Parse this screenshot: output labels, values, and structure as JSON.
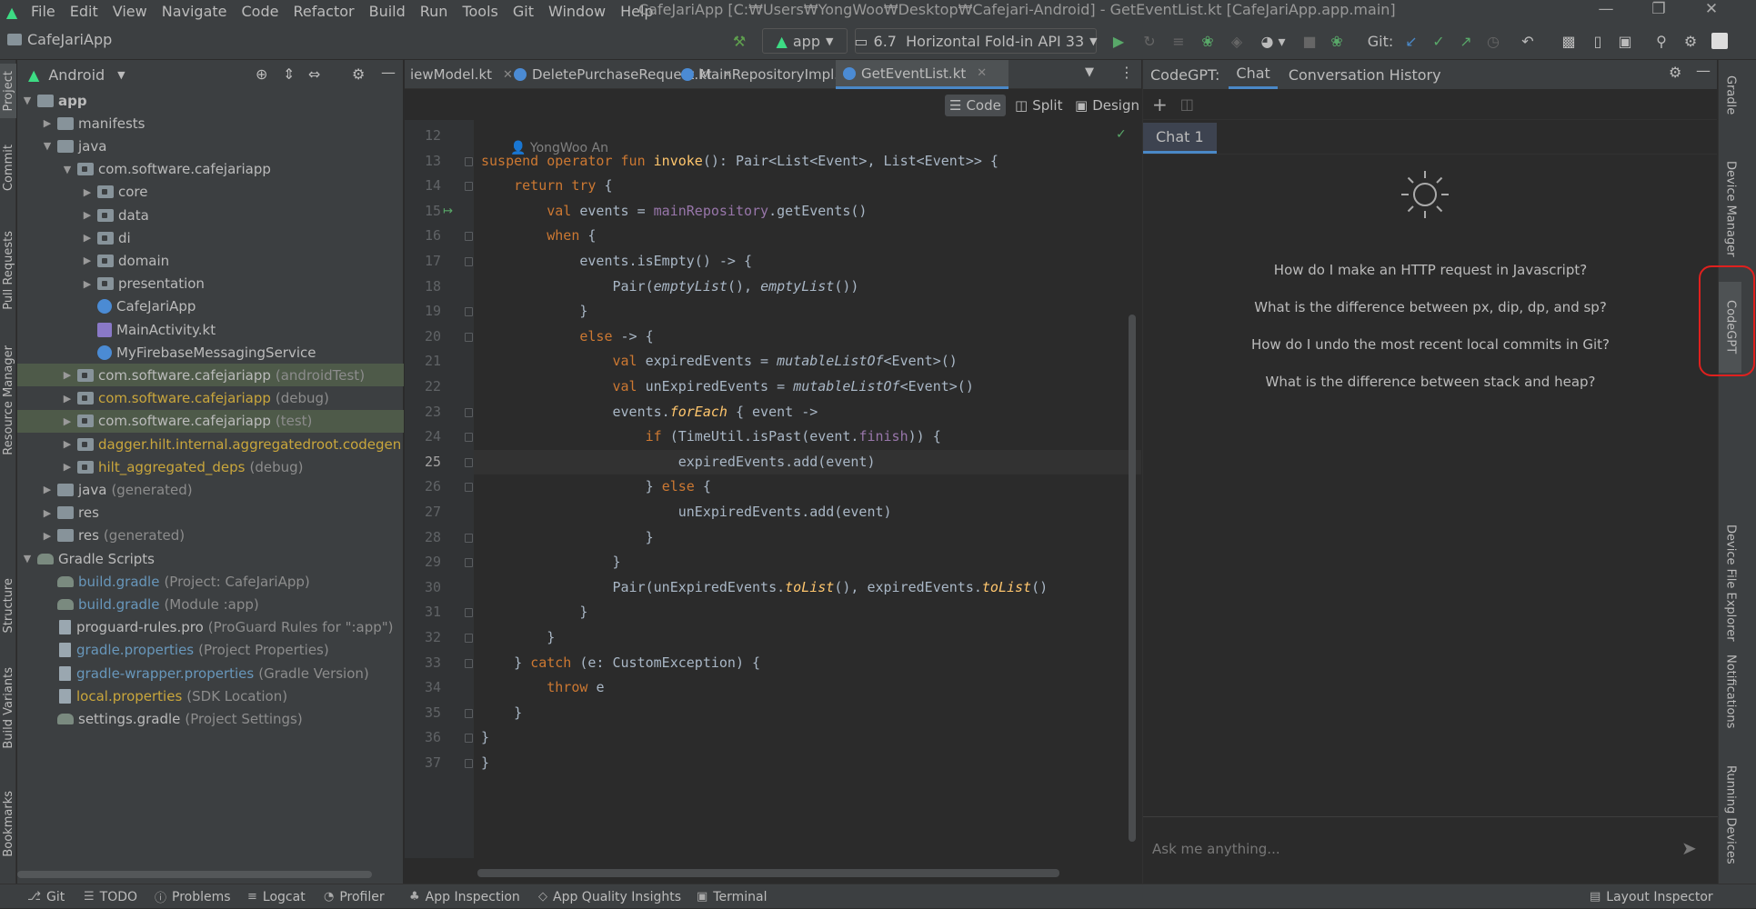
{
  "window": {
    "title": "CafeJariApp [C:₩Users₩YongWoo₩Desktop₩Cafejari-Android] - GetEventList.kt [CafeJariApp.app.main]",
    "menu": [
      "File",
      "Edit",
      "View",
      "Navigate",
      "Code",
      "Refactor",
      "Build",
      "Run",
      "Tools",
      "Git",
      "Window",
      "Help"
    ]
  },
  "toolbar": {
    "project_name": "CafeJariApp",
    "run_config": "app",
    "device": "6.7  Horizontal Fold-in API 33",
    "git_label": "Git:"
  },
  "left_strip": [
    "Project",
    "Commit",
    "Pull Requests",
    "Resource Manager",
    "Structure",
    "Build Variants",
    "Bookmarks"
  ],
  "right_strip": [
    "Gradle",
    "Device Manager",
    "CodeGPT",
    "Device File Explorer",
    "Notifications",
    "Running Devices"
  ],
  "project": {
    "view_mode": "Android",
    "tree": [
      {
        "label": "app",
        "hint": "",
        "depth": 0,
        "icon": "folder",
        "color": "normal",
        "arrow": "down",
        "bold": true
      },
      {
        "label": "manifests",
        "hint": "",
        "depth": 1,
        "icon": "folder",
        "color": "normal",
        "arrow": "right"
      },
      {
        "label": "java",
        "hint": "",
        "depth": 1,
        "icon": "folder",
        "color": "normal",
        "arrow": "down"
      },
      {
        "label": "com.software.cafejariapp",
        "hint": "",
        "depth": 2,
        "icon": "pkg",
        "color": "normal",
        "arrow": "down"
      },
      {
        "label": "core",
        "hint": "",
        "depth": 3,
        "icon": "pkg",
        "color": "normal",
        "arrow": "right"
      },
      {
        "label": "data",
        "hint": "",
        "depth": 3,
        "icon": "pkg",
        "color": "normal",
        "arrow": "right"
      },
      {
        "label": "di",
        "hint": "",
        "depth": 3,
        "icon": "pkg",
        "color": "normal",
        "arrow": "right"
      },
      {
        "label": "domain",
        "hint": "",
        "depth": 3,
        "icon": "pkg",
        "color": "normal",
        "arrow": "right"
      },
      {
        "label": "presentation",
        "hint": "",
        "depth": 3,
        "icon": "pkg",
        "color": "normal",
        "arrow": "right"
      },
      {
        "label": "CafeJariApp",
        "hint": "",
        "depth": 3,
        "icon": "kotlin-class",
        "color": "normal",
        "arrow": "none"
      },
      {
        "label": "MainActivity.kt",
        "hint": "",
        "depth": 3,
        "icon": "kotlin-file",
        "color": "normal",
        "arrow": "none"
      },
      {
        "label": "MyFirebaseMessagingService",
        "hint": "",
        "depth": 3,
        "icon": "kotlin-class",
        "color": "normal",
        "arrow": "none"
      },
      {
        "label": "com.software.cafejariapp",
        "hint": "(androidTest)",
        "depth": 2,
        "icon": "pkg",
        "color": "normal",
        "arrow": "right",
        "selected": true
      },
      {
        "label": "com.software.cafejariapp",
        "hint": "(debug)",
        "depth": 2,
        "icon": "pkg",
        "color": "yellow",
        "arrow": "right"
      },
      {
        "label": "com.software.cafejariapp",
        "hint": "(test)",
        "depth": 2,
        "icon": "pkg",
        "color": "normal",
        "arrow": "right",
        "selected": true
      },
      {
        "label": "dagger.hilt.internal.aggregatedroot.codegen",
        "hint": "(de",
        "depth": 2,
        "icon": "pkg",
        "color": "yellow",
        "arrow": "right"
      },
      {
        "label": "hilt_aggregated_deps",
        "hint": "(debug)",
        "depth": 2,
        "icon": "pkg",
        "color": "yellow",
        "arrow": "right"
      },
      {
        "label": "java",
        "hint": "(generated)",
        "depth": 1,
        "icon": "folder",
        "color": "normal",
        "arrow": "right"
      },
      {
        "label": "res",
        "hint": "",
        "depth": 1,
        "icon": "folder",
        "color": "normal",
        "arrow": "right"
      },
      {
        "label": "res",
        "hint": "(generated)",
        "depth": 1,
        "icon": "folder",
        "color": "normal",
        "arrow": "right"
      },
      {
        "label": "Gradle Scripts",
        "hint": "",
        "depth": 0,
        "icon": "gradle",
        "color": "normal",
        "arrow": "down"
      },
      {
        "label": "build.gradle",
        "hint": "(Project: CafeJariApp)",
        "depth": 1,
        "icon": "gradle",
        "color": "blue",
        "arrow": "none"
      },
      {
        "label": "build.gradle",
        "hint": "(Module :app)",
        "depth": 1,
        "icon": "gradle",
        "color": "blue",
        "arrow": "none"
      },
      {
        "label": "proguard-rules.pro",
        "hint": "(ProGuard Rules for \":app\")",
        "depth": 1,
        "icon": "file",
        "color": "normal",
        "arrow": "none"
      },
      {
        "label": "gradle.properties",
        "hint": "(Project Properties)",
        "depth": 1,
        "icon": "file",
        "color": "blue",
        "arrow": "none"
      },
      {
        "label": "gradle-wrapper.properties",
        "hint": "(Gradle Version)",
        "depth": 1,
        "icon": "file",
        "color": "blue",
        "arrow": "none"
      },
      {
        "label": "local.properties",
        "hint": "(SDK Location)",
        "depth": 1,
        "icon": "file",
        "color": "yellow",
        "arrow": "none"
      },
      {
        "label": "settings.gradle",
        "hint": "(Project Settings)",
        "depth": 1,
        "icon": "gradle",
        "color": "normal",
        "arrow": "none"
      }
    ]
  },
  "editor": {
    "tabs": [
      {
        "label": "iewModel.kt",
        "active": false
      },
      {
        "label": "DeletePurchaseRequest.kt",
        "active": false
      },
      {
        "label": "MainRepositoryImpl.kt",
        "active": false
      },
      {
        "label": "GetEventList.kt",
        "active": true
      }
    ],
    "modes": [
      "Code",
      "Split",
      "Design"
    ],
    "author": "YongWoo An",
    "first_line": 12,
    "current_line": 25,
    "lines": [
      [],
      [
        [
          "kw",
          "suspend operator fun "
        ],
        [
          "fn",
          "invoke"
        ],
        [
          "",
          "(): Pair<List<Event>, List<Event>> {"
        ]
      ],
      [
        [
          "",
          "    "
        ],
        [
          "kw",
          "return try "
        ],
        [
          "",
          "{"
        ]
      ],
      [
        [
          "",
          "        "
        ],
        [
          "kw",
          "val "
        ],
        [
          "",
          "events = "
        ],
        [
          "pp",
          "mainRepository"
        ],
        [
          "",
          ".getEvents()"
        ]
      ],
      [
        [
          "",
          "        "
        ],
        [
          "kw",
          "when "
        ],
        [
          "",
          "{"
        ]
      ],
      [
        [
          "",
          "            events.isEmpty() -> {"
        ]
      ],
      [
        [
          "",
          "                Pair("
        ],
        [
          "it",
          "emptyList"
        ],
        [
          "",
          "(), "
        ],
        [
          "it",
          "emptyList"
        ],
        [
          "",
          "())"
        ]
      ],
      [
        [
          "",
          "            }"
        ]
      ],
      [
        [
          "",
          "            "
        ],
        [
          "kw",
          "else "
        ],
        [
          "",
          "-> {"
        ]
      ],
      [
        [
          "",
          "                "
        ],
        [
          "kw",
          "val "
        ],
        [
          "",
          "expiredEvents = "
        ],
        [
          "it",
          "mutableListOf"
        ],
        [
          "",
          "<Event>()"
        ]
      ],
      [
        [
          "",
          "                "
        ],
        [
          "kw",
          "val "
        ],
        [
          "",
          "unExpiredEvents = "
        ],
        [
          "it",
          "mutableListOf"
        ],
        [
          "",
          "<Event>()"
        ]
      ],
      [
        [
          "",
          "                events."
        ],
        [
          "itf",
          "forEach"
        ],
        [
          "",
          " { event ->"
        ]
      ],
      [
        [
          "",
          "                    "
        ],
        [
          "kw",
          "if "
        ],
        [
          "",
          "(TimeUtil.isPast(event."
        ],
        [
          "pp",
          "finish"
        ],
        [
          "",
          ")) {"
        ]
      ],
      [
        [
          "",
          "                        expiredEvents.add(event)"
        ]
      ],
      [
        [
          "",
          "                    } "
        ],
        [
          "kw",
          "else "
        ],
        [
          "",
          "{"
        ]
      ],
      [
        [
          "",
          "                        unExpiredEvents.add(event)"
        ]
      ],
      [
        [
          "",
          "                    }"
        ]
      ],
      [
        [
          "",
          "                }"
        ]
      ],
      [
        [
          "",
          "                Pair(unExpiredEvents."
        ],
        [
          "itf",
          "toList"
        ],
        [
          "",
          "(), expiredEvents."
        ],
        [
          "itf",
          "toList"
        ],
        [
          "",
          "()"
        ]
      ],
      [
        [
          "",
          "            }"
        ]
      ],
      [
        [
          "",
          "        }"
        ]
      ],
      [
        [
          "",
          "    } "
        ],
        [
          "kw",
          "catch "
        ],
        [
          "",
          "(e: CustomException) {"
        ]
      ],
      [
        [
          "",
          "        "
        ],
        [
          "kw",
          "throw "
        ],
        [
          "",
          "e"
        ]
      ],
      [
        [
          "",
          "    }"
        ]
      ],
      [
        [
          "",
          "}"
        ]
      ],
      [
        [
          "",
          "}"
        ]
      ]
    ]
  },
  "codegpt": {
    "title": "CodeGPT:",
    "tabs": [
      "Chat",
      "Conversation History"
    ],
    "chat_tab": "Chat 1",
    "suggestions": [
      "How do I make an HTTP request in Javascript?",
      "What is the difference between px, dip, dp, and sp?",
      "How do I undo the most recent local commits in Git?",
      "What is the difference between stack and heap?"
    ],
    "input_placeholder": "Ask me anything..."
  },
  "statusbar": {
    "items": [
      "Git",
      "TODO",
      "Problems",
      "Logcat",
      "Profiler",
      "App Inspection",
      "App Quality Insights",
      "Terminal"
    ],
    "right": "Layout Inspector"
  },
  "colors": {
    "annotation": "#e0201e",
    "accent": "#4a88c7",
    "android_green": "#3ddc84"
  }
}
